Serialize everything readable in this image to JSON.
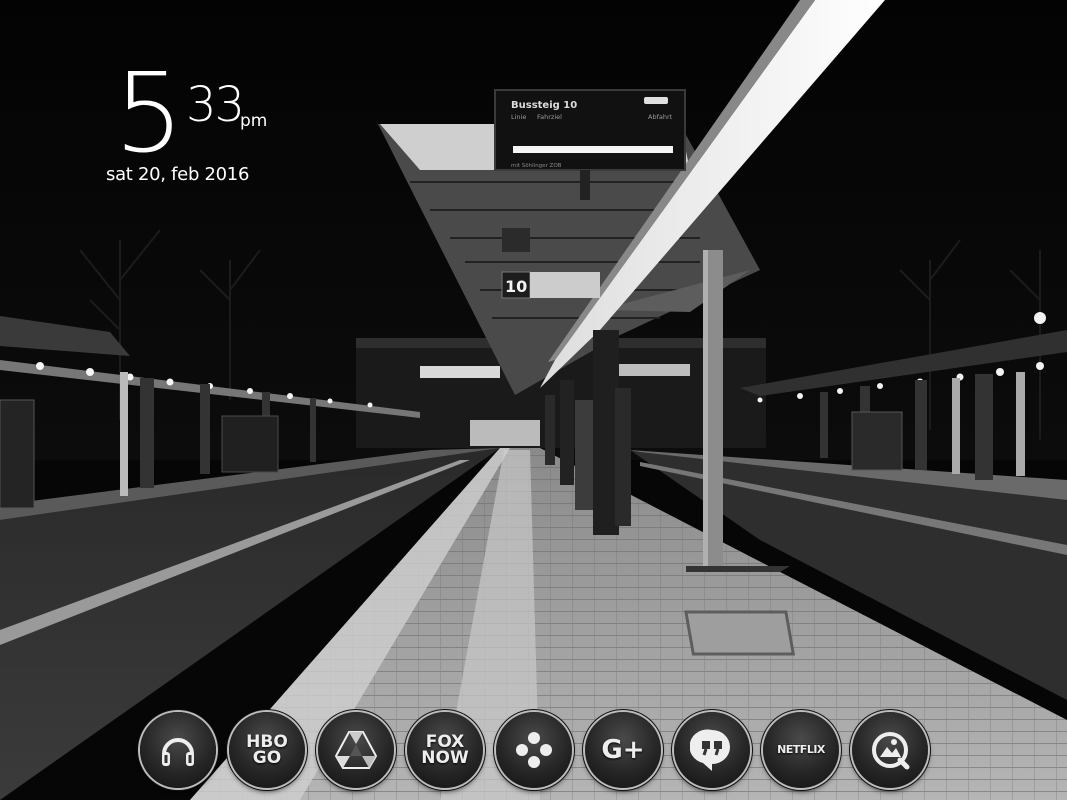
{
  "clock": {
    "hour": "5",
    "minutes": "33",
    "ampm": "pm",
    "date": "sat 20, feb 2016"
  },
  "wallpaper": {
    "sign_title": "Bussteig 10",
    "sign_col1": "Linie",
    "sign_col2": "Fahrziel",
    "sign_col3": "Abfahrt",
    "sign_footer": "mit Söhlinger ZOB",
    "platform_number": "10"
  },
  "dock": {
    "apps": [
      {
        "id": "headphones",
        "icon": "headphones-icon"
      },
      {
        "id": "hbo-go",
        "label_line1": "HBO",
        "label_line2": "GO"
      },
      {
        "id": "google-drive",
        "icon": "drive-icon"
      },
      {
        "id": "fox-now",
        "label_line1": "FOX",
        "label_line2": "NOW"
      },
      {
        "id": "game-controller",
        "icon": "gamepad-icon"
      },
      {
        "id": "google-plus",
        "label": "G+"
      },
      {
        "id": "hangouts",
        "icon": "quote-bubble-icon"
      },
      {
        "id": "netflix",
        "label": "NETFLIX"
      },
      {
        "id": "gallery",
        "icon": "gallery-icon"
      }
    ]
  },
  "colors": {
    "background": "#060606",
    "text": "#ffffff",
    "icon_ring": "#bdbdbd"
  }
}
